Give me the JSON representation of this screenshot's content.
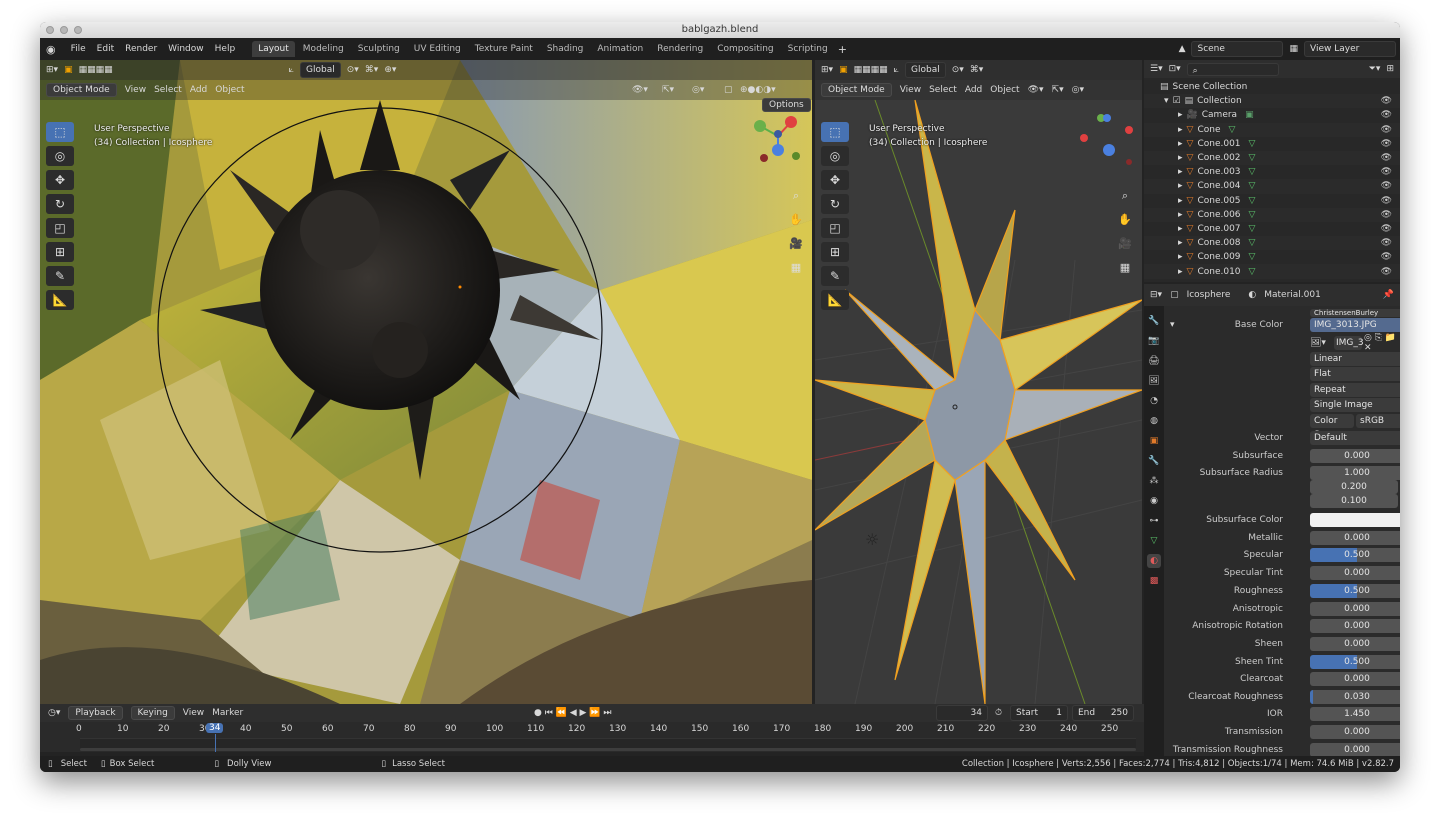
{
  "window": {
    "title": "bablgazh.blend"
  },
  "menu": [
    "File",
    "Edit",
    "Render",
    "Window",
    "Help"
  ],
  "workspaces": [
    {
      "label": "Layout",
      "active": true
    },
    {
      "label": "Modeling"
    },
    {
      "label": "Sculpting"
    },
    {
      "label": "UV Editing"
    },
    {
      "label": "Texture Paint"
    },
    {
      "label": "Shading"
    },
    {
      "label": "Animation"
    },
    {
      "label": "Rendering"
    },
    {
      "label": "Compositing"
    },
    {
      "label": "Scripting"
    }
  ],
  "top_right": {
    "scene": "Scene",
    "view_layer": "View Layer"
  },
  "viewport_left": {
    "orientation": "Global",
    "mode": "Object Mode",
    "menus": [
      "View",
      "Select",
      "Add",
      "Object"
    ],
    "options": "Options",
    "info_line1": "User Perspective",
    "info_line2": "(34) Collection | Icosphere"
  },
  "viewport_right": {
    "orientation": "Global",
    "mode": "Object Mode",
    "menus": [
      "View",
      "Select",
      "Add",
      "Object"
    ],
    "info_line1": "User Perspective",
    "info_line2": "(34) Collection | Icosphere"
  },
  "outliner": {
    "root": "Scene Collection",
    "collection": "Collection",
    "items": [
      "Camera",
      "Cone",
      "Cone.001",
      "Cone.002",
      "Cone.003",
      "Cone.004",
      "Cone.005",
      "Cone.006",
      "Cone.007",
      "Cone.008",
      "Cone.009",
      "Cone.010"
    ]
  },
  "properties": {
    "object": "Icosphere",
    "material": "Material.001",
    "truncated_top": "ChristensenBurley",
    "base_color_label": "Base Color",
    "base_color_value": "IMG_3013.JPG",
    "image_name": "IMG_3",
    "interp": "Linear",
    "proj": "Flat",
    "ext": "Repeat",
    "source": "Single Image",
    "color_space_label": "Color Space",
    "color_space": "sRGB",
    "vector_label": "Vector",
    "vector": "Default",
    "rows": [
      {
        "label": "Subsurface",
        "value": "0.000",
        "fill": 0
      },
      {
        "label": "Subsurface Radius",
        "value": "1.000",
        "fill": 0
      },
      {
        "label": "",
        "value": "0.200",
        "fill": 0
      },
      {
        "label": "",
        "value": "0.100",
        "fill": 0
      },
      {
        "label": "Subsurface Color",
        "value": "",
        "fill": 0,
        "white": true
      },
      {
        "label": "Metallic",
        "value": "0.000",
        "fill": 0
      },
      {
        "label": "Specular",
        "value": "0.500",
        "fill": 0.5
      },
      {
        "label": "Specular Tint",
        "value": "0.000",
        "fill": 0
      },
      {
        "label": "Roughness",
        "value": "0.500",
        "fill": 0.5
      },
      {
        "label": "Anisotropic",
        "value": "0.000",
        "fill": 0
      },
      {
        "label": "Anisotropic Rotation",
        "value": "0.000",
        "fill": 0
      },
      {
        "label": "Sheen",
        "value": "0.000",
        "fill": 0
      },
      {
        "label": "Sheen Tint",
        "value": "0.500",
        "fill": 0.5
      },
      {
        "label": "Clearcoat",
        "value": "0.000",
        "fill": 0
      },
      {
        "label": "Clearcoat Roughness",
        "value": "0.030",
        "fill": 0.03
      },
      {
        "label": "IOR",
        "value": "1.450",
        "fill": 0
      },
      {
        "label": "Transmission",
        "value": "0.000",
        "fill": 0
      },
      {
        "label": "Transmission Roughness",
        "value": "0.000",
        "fill": 0
      }
    ]
  },
  "timeline": {
    "menus": [
      "Playback",
      "Keying",
      "View",
      "Marker"
    ],
    "current_frame": "34",
    "start_label": "Start",
    "start": "1",
    "end_label": "End",
    "end": "250",
    "ticks": [
      "0",
      "10",
      "20",
      "30",
      "40",
      "50",
      "60",
      "70",
      "80",
      "90",
      "100",
      "110",
      "120",
      "130",
      "140",
      "150",
      "160",
      "170",
      "180",
      "190",
      "200",
      "210",
      "220",
      "230",
      "240",
      "250"
    ]
  },
  "statusbar": {
    "select": "Select",
    "box_select": "Box Select",
    "dolly": "Dolly View",
    "lasso": "Lasso Select",
    "stats": "Collection | Icosphere | Verts:2,556 | Faces:2,774 | Tris:4,812 | Objects:1/74 | Mem: 74.6 MiB | v2.82.7"
  }
}
